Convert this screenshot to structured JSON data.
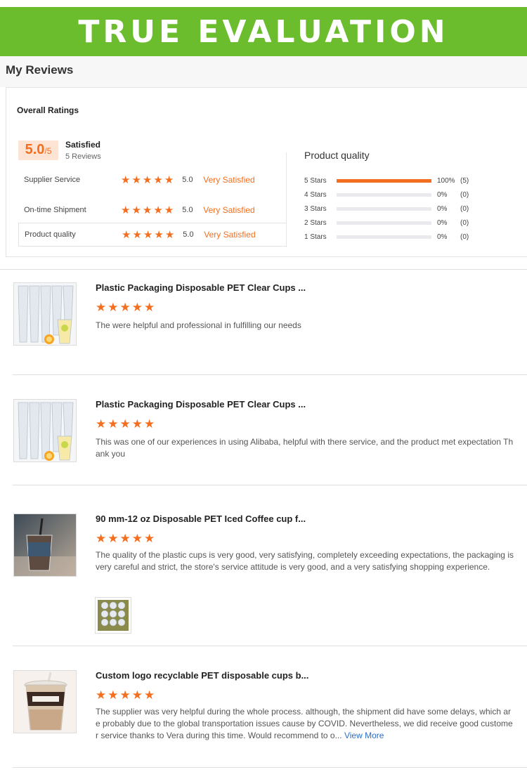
{
  "banner": {
    "title": "TRUE EVALUATION"
  },
  "page": {
    "title": "My Reviews"
  },
  "overall": {
    "label": "Overall Ratings",
    "score": "5.0",
    "score_max": "/5",
    "satisfaction": "Satisfied",
    "review_count": "5 Reviews",
    "rating_value": 5,
    "sub_ratings": [
      {
        "label": "Supplier Service",
        "score": "5.0",
        "text": "Very Satisfied",
        "stars": 5
      },
      {
        "label": "On-time Shipment",
        "score": "5.0",
        "text": "Very Satisfied",
        "stars": 5
      },
      {
        "label": "Product quality",
        "score": "5.0",
        "text": "Very Satisfied",
        "stars": 5
      }
    ]
  },
  "distribution": {
    "title": "Product quality",
    "rows": [
      {
        "label": "5 Stars",
        "percent_text": "100%",
        "count": "(5)",
        "fraction": 1.0
      },
      {
        "label": "4 Stars",
        "percent_text": "0%",
        "count": "(0)",
        "fraction": 0
      },
      {
        "label": "3 Stars",
        "percent_text": "0%",
        "count": "(0)",
        "fraction": 0
      },
      {
        "label": "2 Stars",
        "percent_text": "0%",
        "count": "(0)",
        "fraction": 0
      },
      {
        "label": "1 Stars",
        "percent_text": "0%",
        "count": "(0)",
        "fraction": 0
      }
    ]
  },
  "colors": {
    "banner": "#6cbd2e",
    "accent": "#f36f1f",
    "link": "#2b6fc4"
  },
  "reviews": [
    {
      "product": "Plastic Packaging Disposable PET Clear Cups ...",
      "stars": 5,
      "text": "The were helpful and professional in fulfilling our needs"
    },
    {
      "product": "Plastic Packaging Disposable PET Clear Cups ...",
      "stars": 5,
      "text": "This was one of our experiences in using Alibaba, helpful with there service, and the product met expectation  Thank you"
    },
    {
      "product": "90 mm-12 oz Disposable PET Iced Coffee cup f...",
      "stars": 5,
      "text": "The quality of the plastic cups is very good, very satisfying, completely exceeding expectations, the packaging is very careful and strict, the store's service attitude is very good, and a very satisfying shopping experience."
    },
    {
      "product": "Custom logo recyclable PET disposable cups b...",
      "stars": 5,
      "text": "The supplier was very helpful during the whole process. although, the shipment did have some delays, which are probably due to the global transportation issues cause by COVID. Nevertheless, we did receive good customer service thanks to Vera during this time. Would recommend to o...",
      "more": "View More"
    }
  ]
}
